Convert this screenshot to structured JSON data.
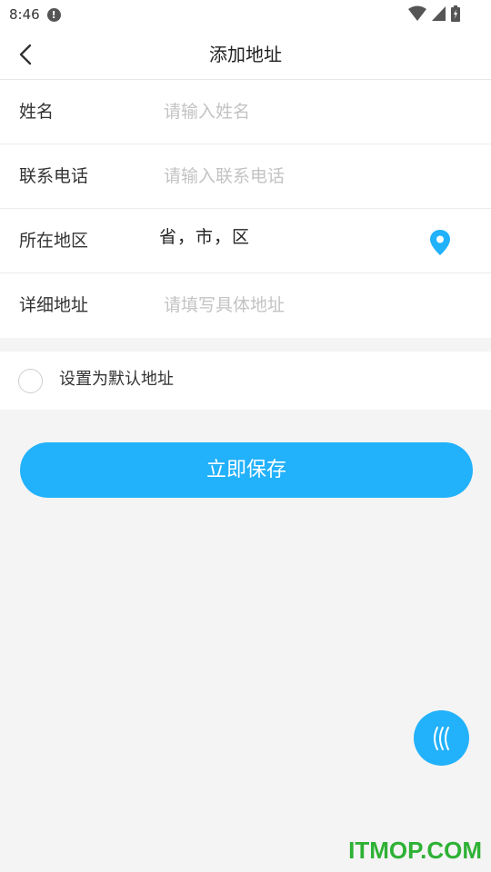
{
  "status_bar": {
    "time": "8:46",
    "icons": [
      "alert-icon",
      "wifi-icon",
      "signal-icon",
      "battery-icon"
    ]
  },
  "header": {
    "title": "添加地址",
    "back_icon": "chevron-left-icon"
  },
  "form": {
    "name": {
      "label": "姓名",
      "placeholder": "请输入姓名",
      "value": ""
    },
    "phone": {
      "label": "联系电话",
      "placeholder": "请输入联系电话",
      "value": ""
    },
    "region": {
      "label": "所在地区",
      "value": "省，市，区",
      "icon": "location-pin-icon"
    },
    "detail": {
      "label": "详细地址",
      "placeholder": "请填写具体地址",
      "value": ""
    }
  },
  "default_option": {
    "label": "设置为默认地址",
    "checked": false
  },
  "save_button": {
    "label": "立即保存"
  },
  "watermark": "ITMOP.COM",
  "colors": {
    "accent": "#22b1fb",
    "background": "#f4f4f4",
    "placeholder": "#c3c3c3",
    "watermark": "#2eb135"
  }
}
